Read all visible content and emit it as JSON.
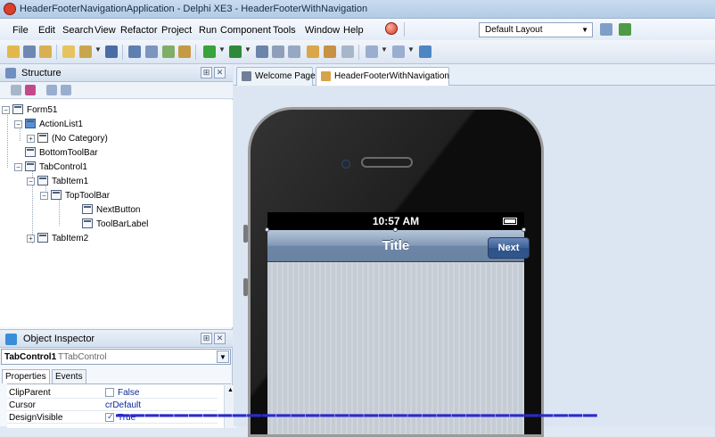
{
  "window": {
    "title": "HeaderFooterNavigationApplication - Delphi XE3 - HeaderFooterWithNavigation"
  },
  "menu": {
    "items": [
      "File",
      "Edit",
      "Search",
      "View",
      "Refactor",
      "Project",
      "Run",
      "Component",
      "Tools",
      "Window",
      "Help"
    ]
  },
  "layout_combo": {
    "value": "Default Layout"
  },
  "structure": {
    "title": "Structure",
    "tree": [
      {
        "label": "Form51",
        "icon": "form-icon"
      },
      {
        "label": "ActionList1",
        "icon": "actionlist-icon"
      },
      {
        "label": "(No Category)",
        "icon": "category-icon"
      },
      {
        "label": "BottomToolBar",
        "icon": "component-icon"
      },
      {
        "label": "TabControl1",
        "icon": "component-icon"
      },
      {
        "label": "TabItem1",
        "icon": "component-icon"
      },
      {
        "label": "TopToolBar",
        "icon": "component-icon"
      },
      {
        "label": "NextButton",
        "icon": "component-icon"
      },
      {
        "label": "ToolBarLabel",
        "icon": "component-icon"
      },
      {
        "label": "TabItem2",
        "icon": "component-icon"
      }
    ]
  },
  "object_inspector": {
    "title": "Object Inspector",
    "selected_name": "TabControl1",
    "selected_type": "TTabControl",
    "tabs": [
      "Properties",
      "Events"
    ],
    "properties": [
      {
        "name": "ClipParent",
        "value": "False",
        "checked": false
      },
      {
        "name": "Cursor",
        "value": "crDefault"
      },
      {
        "name": "DesignVisible",
        "value": "True",
        "checked": true
      }
    ]
  },
  "document_tabs": [
    {
      "label": "Welcome Page",
      "active": false
    },
    {
      "label": "HeaderFooterWithNavigation",
      "active": true
    }
  ],
  "designer": {
    "status_time": "10:57 AM",
    "nav_title": "Title",
    "next_button": "Next"
  },
  "colors": {
    "accent": "#3d6196",
    "bottom_text": "#2a2ad0"
  }
}
